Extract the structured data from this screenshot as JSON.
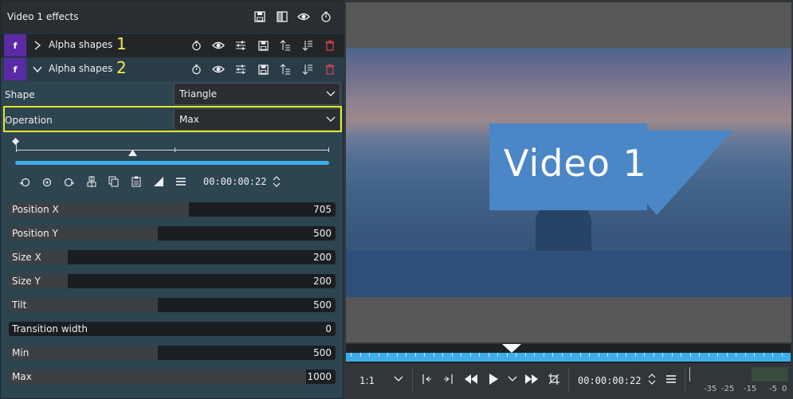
{
  "effects_panel": {
    "title": "Video 1 effects",
    "effects": [
      {
        "badge": "f",
        "name": "Alpha shapes",
        "number": "1",
        "expanded": false
      },
      {
        "badge": "f",
        "name": "Alpha shapes",
        "number": "2",
        "expanded": true
      }
    ],
    "shape": {
      "label": "Shape",
      "value": "Triangle"
    },
    "operation": {
      "label": "Operation",
      "value": "Max"
    },
    "keyframe_timecode": "00:00:00:22",
    "params": [
      {
        "label": "Position X",
        "value": "705",
        "fraction": 0.55
      },
      {
        "label": "Position Y",
        "value": "500",
        "fraction": 0.455
      },
      {
        "label": "Size X",
        "value": "200",
        "fraction": 0.18
      },
      {
        "label": "Size Y",
        "value": "200",
        "fraction": 0.18
      },
      {
        "label": "Tilt",
        "value": "500",
        "fraction": 0.455
      },
      {
        "label": "Transition width",
        "value": "0",
        "fraction": 0.0
      },
      {
        "label": "Min",
        "value": "500",
        "fraction": 0.455
      },
      {
        "label": "Max",
        "value": "1000",
        "fraction": 0.91
      }
    ]
  },
  "monitor": {
    "video_title": "Video 1",
    "zoom": "1:1",
    "timecode": "00:00:00:22",
    "audio_meter_labels": [
      "-35",
      "-25",
      "-15",
      "-5",
      "0"
    ]
  },
  "colors": {
    "accent": "#3daee9",
    "highlight": "#e5e62a",
    "effect_badge": "#5a2aa6",
    "title_shape": "#4b86c6",
    "delete": "#da4453"
  }
}
